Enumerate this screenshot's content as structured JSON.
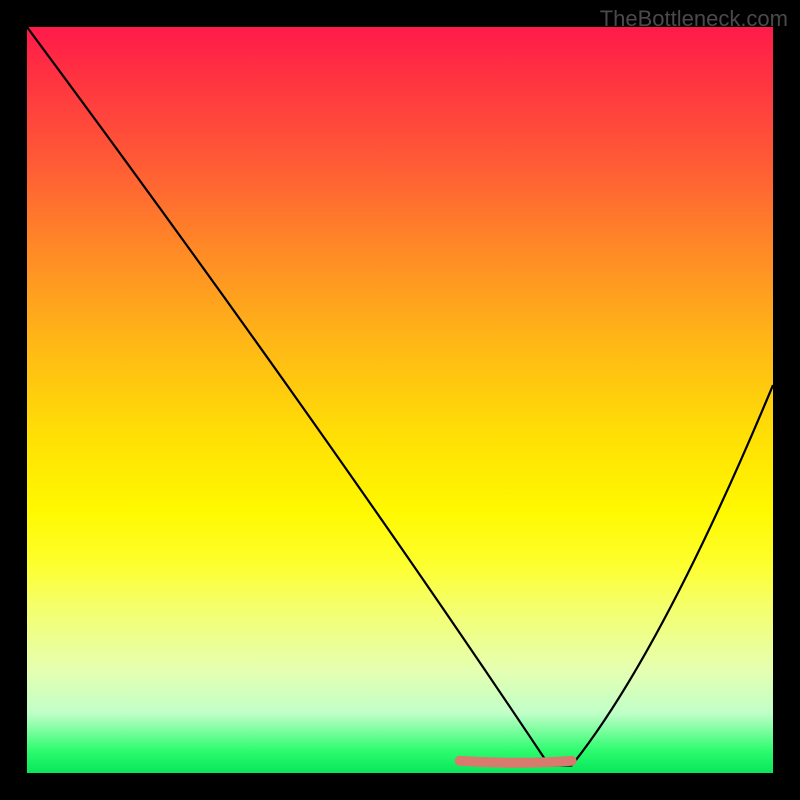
{
  "watermark": "TheBottleneck.com",
  "chart_data": {
    "type": "line",
    "title": "",
    "xlabel": "",
    "ylabel": "",
    "xlim": [
      0,
      100
    ],
    "ylim": [
      0,
      100
    ],
    "gradient_colors": {
      "top": "#ff1a4a",
      "mid": "#fff900",
      "bottom": "#08e65a"
    },
    "curve": {
      "x": [
        0,
        10,
        20,
        30,
        40,
        50,
        56,
        60,
        65,
        70,
        73,
        78,
        85,
        92,
        100
      ],
      "y_percent": [
        100,
        88,
        74,
        60,
        46,
        30,
        20,
        12,
        4,
        1,
        1,
        4,
        16,
        32,
        52
      ]
    },
    "flat_marker": {
      "color": "#d87a6e",
      "x_start": 58,
      "x_end": 73,
      "y_percent": 1.5
    },
    "axes_visible": false,
    "legend": false
  }
}
